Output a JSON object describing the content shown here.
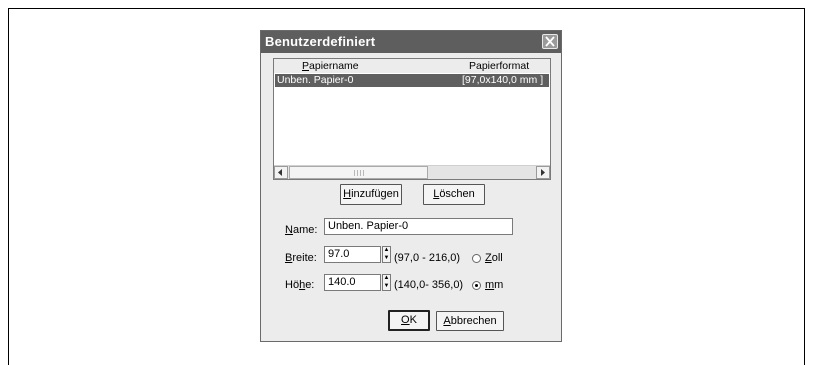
{
  "dialog": {
    "title": "Benutzerdefiniert",
    "list": {
      "columns": {
        "name_prefix": "",
        "name_underlined": "P",
        "name_rest": "apiername",
        "format": "Papierformat"
      },
      "rows": [
        {
          "name": "Unben. Papier-0",
          "format": "[97,0x140,0 mm ]"
        }
      ]
    },
    "buttons": {
      "add_u": "H",
      "add_rest": "inzufügen",
      "delete_u": "L",
      "delete_rest": "öschen",
      "ok_u": "O",
      "ok_rest": "K",
      "cancel_u": "A",
      "cancel_rest": "bbrechen"
    },
    "fields": {
      "name_label_u": "N",
      "name_label_rest": "ame:",
      "name_value": "Unben. Papier-0",
      "width_label_u": "B",
      "width_label_rest": "reite:",
      "width_value": "97.0",
      "width_range": "(97,0 - 216,0)",
      "height_label_pre": "Hö",
      "height_label_u": "h",
      "height_label_rest": "e:",
      "height_value": "140.0",
      "height_range": "(140,0- 356,0)"
    },
    "units": {
      "inch_u": "Z",
      "inch_rest": "oll",
      "inch_selected": false,
      "mm_u": "m",
      "mm_rest": "m",
      "mm_selected": true
    }
  }
}
